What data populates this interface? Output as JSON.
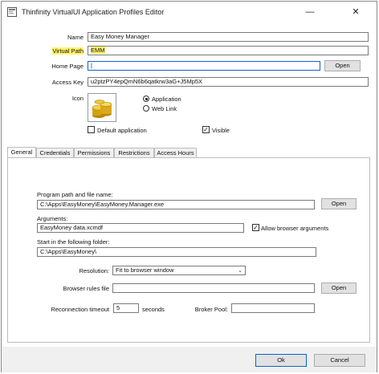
{
  "window": {
    "title": "Thinfinity VirtualUI Application Profiles Editor",
    "minimize_glyph": "—",
    "close_glyph": "✕"
  },
  "profile": {
    "name_label": "Name",
    "name_value": "Easy Money Manager",
    "virtual_path_label": "Virtual Path",
    "virtual_path_value": "EMM",
    "home_page_label": "Home Page",
    "home_page_value": "|",
    "home_page_open": "Open",
    "access_key_label": "Access Key",
    "access_key_value": "u2ptzPY4epQmN6b6qatkrw3aG+J5Mp5X",
    "icon_label": "Icon",
    "icon_name": "gold-coins-icon",
    "type_options": [
      "Application",
      "Web Link"
    ],
    "type_selected": "Application",
    "default_app_label": "Default application",
    "default_app_checked": false,
    "visible_label": "Visible",
    "visible_checked": true
  },
  "tabs": [
    {
      "label": "General",
      "active": true
    },
    {
      "label": "Credentials",
      "active": false
    },
    {
      "label": "Permissions",
      "active": false
    },
    {
      "label": "Restrictions",
      "active": false
    },
    {
      "label": "Access Hours",
      "active": false
    }
  ],
  "general": {
    "program_label": "Program path and file name:",
    "program_value": "C:\\Apps\\EasyMoney\\EasyMoney.Manager.exe",
    "program_open": "Open",
    "arguments_label": "Arguments:",
    "arguments_value": "EasyMoney data.xcmdf",
    "allow_browser_args_label": "Allow browser arguments",
    "allow_browser_args_checked": true,
    "start_in_label": "Start in the following folder:",
    "start_in_value": "C:\\Apps\\EasyMoney\\",
    "resolution_label": "Resolution:",
    "resolution_value": "Fit to browser window",
    "browser_rules_label": "Browser rules file",
    "browser_rules_value": "",
    "browser_rules_open": "Open",
    "reconnection_label": "Reconnection timeout",
    "reconnection_value": "5",
    "reconnection_unit": "seconds",
    "broker_pool_label": "Broker Pool:",
    "broker_pool_value": ""
  },
  "footer": {
    "ok_label": "Ok",
    "cancel_label": "Cancel"
  },
  "colors": {
    "highlight": "#fff36a",
    "focus_border": "#0a64c8",
    "button_face": "#e1e1e1"
  }
}
